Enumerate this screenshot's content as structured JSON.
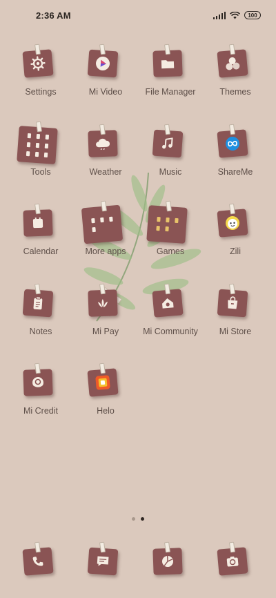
{
  "status_bar": {
    "time": "2:36 AM",
    "battery": "100",
    "icons": [
      "signal-icon",
      "wifi-icon",
      "battery-icon"
    ]
  },
  "apps": [
    {
      "label": "Settings",
      "icon": "gear-icon"
    },
    {
      "label": "Mi Video",
      "icon": "play-icon"
    },
    {
      "label": "File Manager",
      "icon": "folder-icon"
    },
    {
      "label": "Themes",
      "icon": "themes-icon"
    },
    {
      "label": "Tools",
      "icon": "folder-grid-icon"
    },
    {
      "label": "Weather",
      "icon": "cloud-icon"
    },
    {
      "label": "Music",
      "icon": "music-note-icon"
    },
    {
      "label": "ShareMe",
      "icon": "shareme-icon"
    },
    {
      "label": "Calendar",
      "icon": "calendar-icon"
    },
    {
      "label": "More apps",
      "icon": "folder-grid-icon"
    },
    {
      "label": "Games",
      "icon": "folder-grid-icon"
    },
    {
      "label": "Zili",
      "icon": "zili-icon"
    },
    {
      "label": "Notes",
      "icon": "notes-icon"
    },
    {
      "label": "Mi Pay",
      "icon": "mi-pay-icon"
    },
    {
      "label": "Mi Community",
      "icon": "home-icon"
    },
    {
      "label": "Mi Store",
      "icon": "store-icon"
    },
    {
      "label": "Mi Credit",
      "icon": "credit-icon"
    },
    {
      "label": "Helo",
      "icon": "helo-icon"
    }
  ],
  "page_indicator": {
    "pages": 2,
    "active": 2
  },
  "dock": [
    {
      "icon": "phone-icon"
    },
    {
      "icon": "message-icon"
    },
    {
      "icon": "browser-icon"
    },
    {
      "icon": "camera-icon"
    }
  ],
  "colors": {
    "background": "#dbc9bd",
    "tile": "#8a5454",
    "label": "#5e4f49"
  }
}
